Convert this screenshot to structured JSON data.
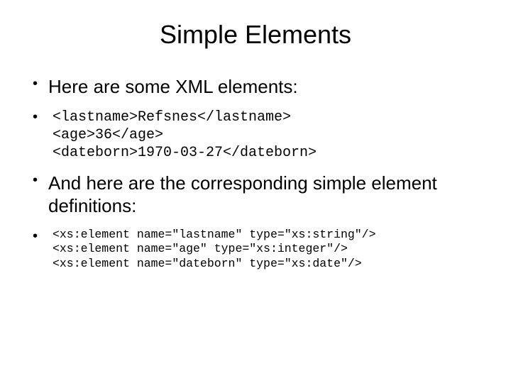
{
  "title": "Simple Elements",
  "bullets": {
    "intro": "Here are some XML elements:",
    "xml_example": "<lastname>Refsnes</lastname>\n<age>36</age>\n<dateborn>1970-03-27</dateborn>",
    "second": "And here are the corresponding simple element definitions:",
    "xsd_example": "<xs:element name=\"lastname\" type=\"xs:string\"/>\n<xs:element name=\"age\" type=\"xs:integer\"/>\n<xs:element name=\"dateborn\" type=\"xs:date\"/>"
  }
}
